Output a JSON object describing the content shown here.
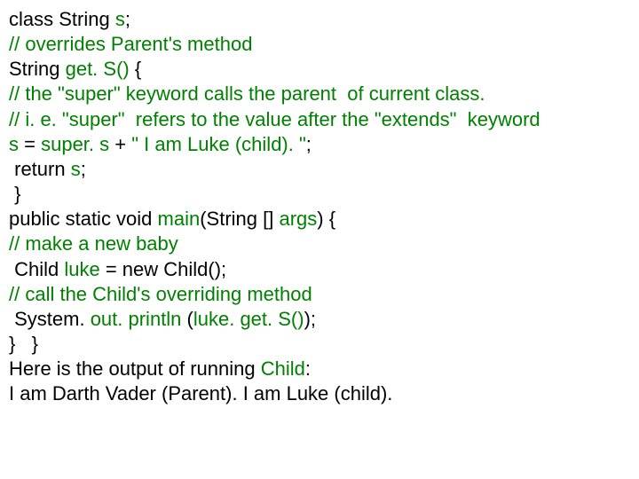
{
  "lines": [
    {
      "parts": [
        {
          "cls": "black",
          "text": "class String "
        },
        {
          "cls": "green",
          "text": "s"
        },
        {
          "cls": "black",
          "text": ";"
        }
      ]
    },
    {
      "parts": [
        {
          "cls": "green",
          "text": "// overrides Parent's method"
        }
      ]
    },
    {
      "parts": [
        {
          "cls": "black",
          "text": "String "
        },
        {
          "cls": "green",
          "text": "get. S()"
        },
        {
          "cls": "black",
          "text": " {"
        }
      ]
    },
    {
      "parts": [
        {
          "cls": "green",
          "text": "// the \"super\" keyword calls the parent  of current class."
        }
      ]
    },
    {
      "parts": [
        {
          "cls": "green",
          "text": "// i. e. \"super\"  refers to the value after the \"extends\"  keyword"
        }
      ]
    },
    {
      "parts": [
        {
          "cls": "green",
          "text": "s "
        },
        {
          "cls": "black",
          "text": "= "
        },
        {
          "cls": "green",
          "text": "super. s "
        },
        {
          "cls": "black",
          "text": "+ "
        },
        {
          "cls": "green",
          "text": "\" I am Luke (child). \""
        },
        {
          "cls": "black",
          "text": ";"
        }
      ]
    },
    {
      "parts": [
        {
          "cls": "black",
          "text": " return "
        },
        {
          "cls": "green",
          "text": "s"
        },
        {
          "cls": "black",
          "text": ";"
        }
      ]
    },
    {
      "parts": [
        {
          "cls": "black",
          "text": " }"
        }
      ]
    },
    {
      "parts": [
        {
          "cls": "black",
          "text": "public static void "
        },
        {
          "cls": "green",
          "text": "main"
        },
        {
          "cls": "black",
          "text": "(String [] "
        },
        {
          "cls": "green",
          "text": "args"
        },
        {
          "cls": "black",
          "text": ") {"
        }
      ]
    },
    {
      "parts": [
        {
          "cls": "green",
          "text": "// make a new baby"
        }
      ]
    },
    {
      "parts": [
        {
          "cls": "black",
          "text": " Child "
        },
        {
          "cls": "green",
          "text": "luke "
        },
        {
          "cls": "black",
          "text": "= new Child();"
        }
      ]
    },
    {
      "parts": [
        {
          "cls": "green",
          "text": "// call the Child's overriding method"
        }
      ]
    },
    {
      "parts": [
        {
          "cls": "black",
          "text": " System. "
        },
        {
          "cls": "green",
          "text": "out. println "
        },
        {
          "cls": "black",
          "text": "("
        },
        {
          "cls": "green",
          "text": "luke. get. S()"
        },
        {
          "cls": "black",
          "text": ");"
        }
      ]
    },
    {
      "parts": [
        {
          "cls": "black",
          "text": "}   }"
        }
      ]
    },
    {
      "parts": [
        {
          "cls": "black",
          "text": "Here is the output of running "
        },
        {
          "cls": "green",
          "text": "Child"
        },
        {
          "cls": "black",
          "text": ":"
        }
      ]
    },
    {
      "parts": [
        {
          "cls": "black",
          "text": "I am Darth Vader (Parent). I am Luke (child)."
        }
      ]
    }
  ]
}
